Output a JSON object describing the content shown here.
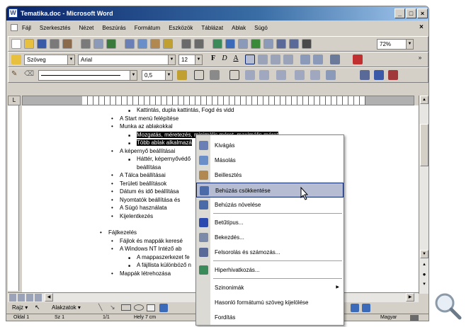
{
  "window": {
    "title": "Tematika.doc - Microsoft Word",
    "close_x": "×"
  },
  "menu": [
    "Fájl",
    "Szerkesztés",
    "Nézet",
    "Beszúrás",
    "Formátum",
    "Eszközök",
    "Táblázat",
    "Ablak",
    "Súgó"
  ],
  "toolbar": {
    "zoom": "72%",
    "style": "Szöveg",
    "font": "Arial",
    "size": "12",
    "bold": "F",
    "italic": "D",
    "underline": "A",
    "line_width": "0,5"
  },
  "document": {
    "lines": [
      {
        "text": "Kattintás, dupla kattintás, Fogd és vidd",
        "bullet": "■",
        "level": 2,
        "selected": false
      },
      {
        "text": "A Start menü felépítése",
        "bullet": "•",
        "level": 1,
        "selected": false
      },
      {
        "text": "Munka az ablakokkal",
        "bullet": "•",
        "level": 1,
        "selected": false
      },
      {
        "text": "Mozgatás, méretezés, minimális méret, maximális méret",
        "bullet": "■",
        "level": 2,
        "selected": true
      },
      {
        "text": "Több ablak alkalmazá",
        "bullet": "■",
        "level": 2,
        "selected": true
      },
      {
        "text": "A képernyő beállításai",
        "bullet": "•",
        "level": 1,
        "selected": false
      },
      {
        "text": "Háttér, képernyővédő",
        "bullet": "■",
        "level": 2,
        "selected": false
      },
      {
        "text": "beállítása",
        "bullet": "",
        "level": 2,
        "selected": false
      },
      {
        "text": "A Tálca beállításai",
        "bullet": "•",
        "level": 1,
        "selected": false
      },
      {
        "text": "Területi beállítások",
        "bullet": "•",
        "level": 1,
        "selected": false
      },
      {
        "text": "Dátum és idő beállítása",
        "bullet": "•",
        "level": 1,
        "selected": false
      },
      {
        "text": "Nyomtatók beállítása és",
        "bullet": "•",
        "level": 1,
        "selected": false
      },
      {
        "text": "A Súgó használata",
        "bullet": "•",
        "level": 1,
        "selected": false
      },
      {
        "text": "Kijelentkezés",
        "bullet": "•",
        "level": 1,
        "selected": false
      },
      {
        "text": "Fájlkezelés",
        "bullet": "•",
        "level": 0,
        "selected": false,
        "gap": true
      },
      {
        "text": "Fájlok és mappák keresé",
        "bullet": "•",
        "level": 1,
        "selected": false
      },
      {
        "text": "A Windows NT Intéző ab",
        "bullet": "•",
        "level": 1,
        "selected": false
      },
      {
        "text": "A mappaszerkezet fe",
        "bullet": "■",
        "level": 2,
        "selected": false
      },
      {
        "text": "A fájllista különböző n",
        "bullet": "■",
        "level": 2,
        "selected": false
      },
      {
        "text": "Mappák létrehozása",
        "bullet": "•",
        "level": 1,
        "selected": false
      }
    ]
  },
  "context_menu": {
    "items": [
      {
        "label": "Kivágás",
        "icon": "scissors-icon",
        "color": "#6a7fb5",
        "highlight": false
      },
      {
        "label": "Másolás",
        "icon": "copy-icon",
        "color": "#6a8ec8",
        "highlight": false
      },
      {
        "label": "Beillesztés",
        "icon": "paste-icon",
        "color": "#b08850",
        "highlight": false
      },
      {
        "label": "Behúzás csökkentése",
        "icon": "decrease-indent-icon",
        "color": "#4a6aa8",
        "highlight": true
      },
      {
        "label": "Behúzás növelése",
        "icon": "increase-indent-icon",
        "color": "#4a6aa8",
        "highlight": false,
        "sep_after": true
      },
      {
        "label": "Betűtípus...",
        "icon": "font-icon",
        "color": "#2a4ab0",
        "highlight": false
      },
      {
        "label": "Bekezdés...",
        "icon": "paragraph-icon",
        "color": "#7a8aa8",
        "highlight": false
      },
      {
        "label": "Felsorolás és számozás...",
        "icon": "bullets-icon",
        "color": "#5a6a98",
        "highlight": false,
        "sep_after": true
      },
      {
        "label": "Hiperhivatkozás...",
        "icon": "hyperlink-icon",
        "color": "#3a8a5a",
        "highlight": false,
        "sep_after": true
      },
      {
        "label": "Szinonimák",
        "icon": "",
        "color": "",
        "highlight": false,
        "submenu": "▶"
      },
      {
        "label": "Hasonló formátumú szöveg kijelölése",
        "icon": "",
        "color": "",
        "highlight": false
      },
      {
        "label": "Fordítás",
        "icon": "",
        "color": "",
        "highlight": false
      }
    ]
  },
  "drawing": {
    "draw_label": "Rajz",
    "autoshapes_label": "Alakzatok"
  },
  "status": {
    "page": "Oldal 1",
    "section": "Sz 1",
    "pages": "1/1",
    "position": "Hely 7 cm",
    "language": "Magyar"
  }
}
